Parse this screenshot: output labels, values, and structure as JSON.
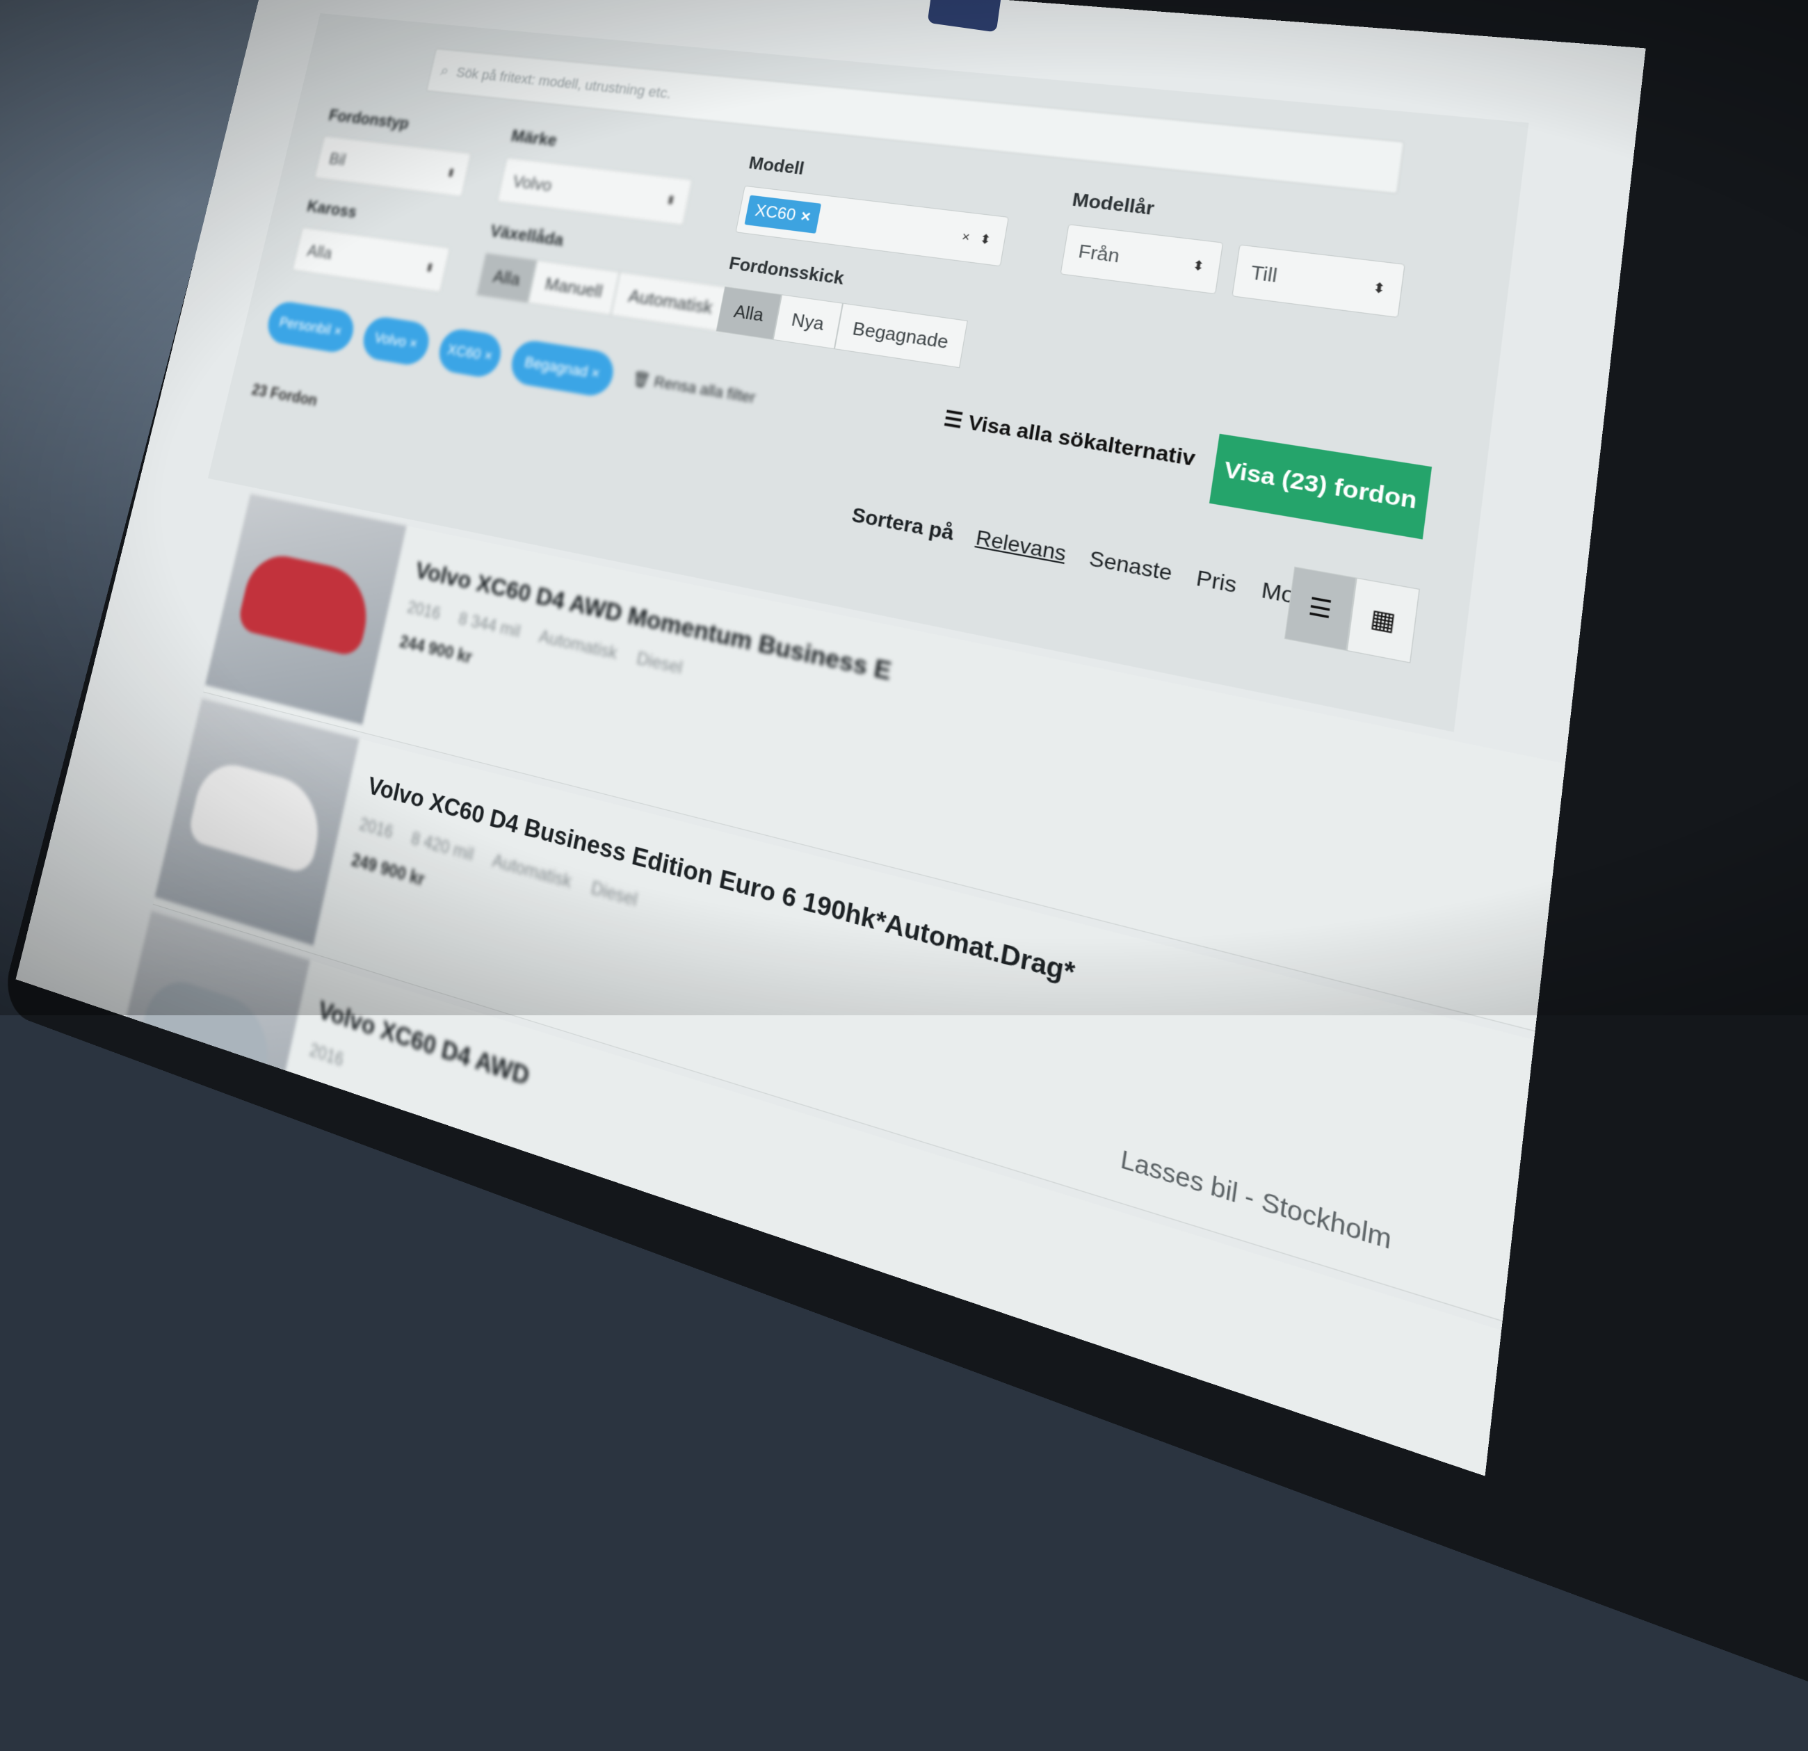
{
  "search": {
    "placeholder": "Sök på fritext: modell, utrustning etc."
  },
  "filters": {
    "vehicle_type_label": "Fordonstyp",
    "vehicle_type_value": "Bil",
    "make_label": "Märke",
    "make_value": "Volvo",
    "body_label": "Kaross",
    "body_value": "Alla",
    "gearbox_label": "Växellåda",
    "gearbox_options": [
      "Alla",
      "Manuell",
      "Automatisk"
    ],
    "model_label": "Modell",
    "model_chip": "XC60",
    "model_clear": "×",
    "condition_label": "Fordonsskick",
    "condition_options": [
      "Alla",
      "Nya",
      "Begagnade"
    ],
    "model_year_label": "Modellår",
    "model_year_from": "Från",
    "model_year_to": "Till",
    "active_pills": [
      "Personbil ×",
      "Volvo ×",
      "XC60 ×",
      "Begagnad ×"
    ],
    "clear_all": "🗑 Rensa alla filter",
    "show_all_options": "☰ Visa alla sökalternativ",
    "show_vehicles_button": "Visa (23) fordon"
  },
  "results": {
    "count_label": "23 Fordon",
    "sort_title": "Sortera på",
    "sort_options": [
      "Relevans",
      "Senaste",
      "Pris",
      "Modellår"
    ],
    "active_sort": "Relevans",
    "view_modes": [
      "list",
      "grid"
    ],
    "active_view": "list",
    "listings": [
      {
        "title": "Volvo XC60 D4 AWD Momentum Business E",
        "year": "2016",
        "mileage": "8 344 mil",
        "gearbox": "Automatisk",
        "fuel": "Diesel",
        "price": "244 900 kr",
        "seller": ""
      },
      {
        "title": "Volvo XC60 D4 Business Edition Euro 6 190hk*Automat.Drag*",
        "year": "2016",
        "mileage": "8 420 mil",
        "gearbox": "Automatisk",
        "fuel": "Diesel",
        "price": "249 900 kr",
        "seller": "Lasses bil - Stockholm"
      },
      {
        "title": "Volvo XC60 D4 AWD",
        "year": "2016",
        "mileage": "",
        "gearbox": "",
        "fuel": "",
        "price": "",
        "seller": ""
      }
    ]
  },
  "colors": {
    "primary_blue": "#3ba5e6",
    "cta_green": "#25a46b",
    "panel_bg": "#dde2e3",
    "screen_bg": "#e6eaeb"
  },
  "icons": {
    "search": "search-icon",
    "list_view": "list-icon",
    "grid_view": "grid-icon",
    "trash": "trash-icon",
    "menu": "menu-icon"
  }
}
